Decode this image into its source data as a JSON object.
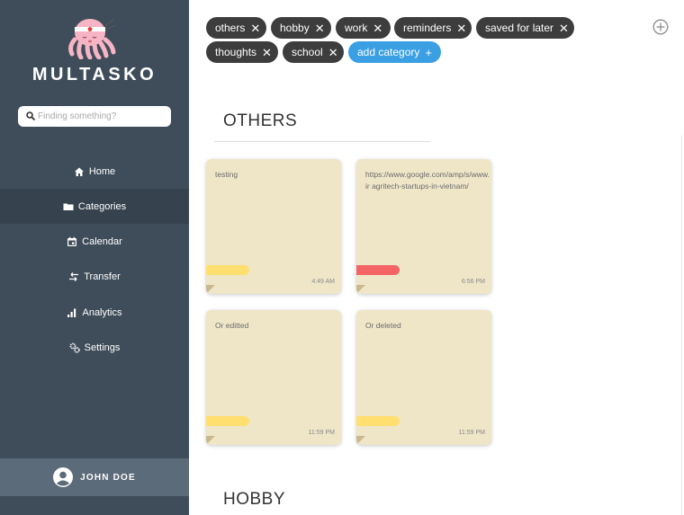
{
  "sidebar": {
    "brand": "MULTASKO",
    "search_placeholder": "Finding something?",
    "items": [
      {
        "label": "Home",
        "icon": "home-icon"
      },
      {
        "label": "Categories",
        "icon": "folder-icon",
        "active": true
      },
      {
        "label": "Calendar",
        "icon": "calendar-icon"
      },
      {
        "label": "Transfer",
        "icon": "transfer-icon"
      },
      {
        "label": "Analytics",
        "icon": "analytics-icon"
      },
      {
        "label": "Settings",
        "icon": "settings-icon"
      }
    ],
    "user_name": "JOHN DOE"
  },
  "categories": [
    {
      "label": "others"
    },
    {
      "label": "hobby"
    },
    {
      "label": "work"
    },
    {
      "label": "reminders"
    },
    {
      "label": "saved for later"
    },
    {
      "label": "thoughts"
    },
    {
      "label": "school"
    }
  ],
  "add_category_label": "add category",
  "sections": [
    {
      "title": "OTHERS",
      "notes": [
        {
          "text": "testing",
          "time": "4:49 AM",
          "tag_color": "#fedf6f"
        },
        {
          "text": "https://www.google.com/amp/s/www.ir agritech-startups-in-vietnam/",
          "time": "6:56 PM",
          "tag_color": "#f46466"
        },
        {
          "text": "Or editted",
          "time": "11:59 PM",
          "tag_color": "#fedf6f"
        },
        {
          "text": "Or deleted",
          "time": "11:59 PM",
          "tag_color": "#fedf6f"
        }
      ]
    },
    {
      "title": "HOBBY"
    }
  ],
  "colors": {
    "sidebar": "#3f4d5a",
    "sidebar_active": "#36434f",
    "user_bar": "#5c6b79",
    "chip": "#3d3d3d",
    "chip_add": "#3a9fe3",
    "note": "#efe6c8"
  }
}
